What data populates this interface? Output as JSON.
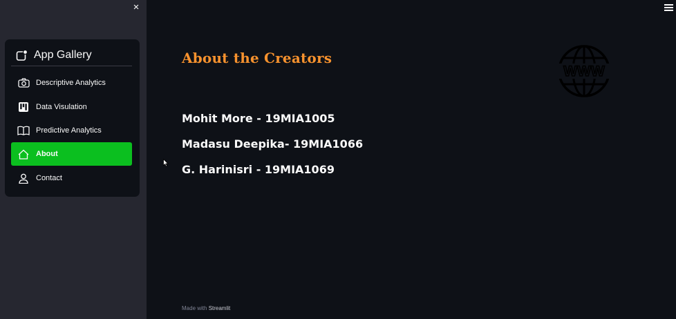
{
  "sidebar": {
    "close_icon": "×",
    "menu": {
      "title": "App Gallery",
      "items": [
        {
          "label": "Descriptive Analytics",
          "icon": "camera-icon"
        },
        {
          "label": "Data Visulation",
          "icon": "kanban-icon"
        },
        {
          "label": "Predictive Analytics",
          "icon": "book-icon"
        },
        {
          "label": "About",
          "icon": "house-icon",
          "active": true
        },
        {
          "label": "Contact",
          "icon": "person-icon"
        }
      ]
    }
  },
  "main": {
    "title": "About the Creators",
    "creators": [
      "Mohit More - 19MIA1005",
      "Madasu Deepika- 19MIA1066",
      "G. Harinisri - 19MIA1069"
    ],
    "logo_text": "WWW"
  },
  "footer": {
    "prefix": "Made with ",
    "brand": "Streamlit"
  },
  "colors": {
    "background": "#0e1117",
    "sidebar": "#262730",
    "accent_active": "#0bbf1f",
    "title": "#f7922e"
  }
}
